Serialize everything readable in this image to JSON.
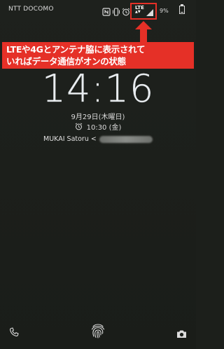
{
  "status_bar": {
    "carrier": "NTT DOCOMO",
    "icons": [
      "nfc-icon",
      "vibrate-icon",
      "alarm-icon",
      "lte-icon",
      "signal-icon",
      "battery-icon"
    ],
    "network_type": "LTE",
    "data_arrows": "▲▼",
    "battery_percent": "9%",
    "battery_level": 0.09
  },
  "annotation": {
    "line1": "LTEや4Gとアンテナ脇に表示されて",
    "line2": "いればデータ通信がオンの状態",
    "color": "#e53027"
  },
  "lockscreen": {
    "time": "14:16",
    "date": "9月29日(木曜日)",
    "alarm": "10:30 (金)",
    "owner": "MUKAI Satoru <"
  },
  "bottom_bar": {
    "icons": [
      "phone-icon",
      "fingerprint-icon",
      "camera-icon"
    ]
  }
}
